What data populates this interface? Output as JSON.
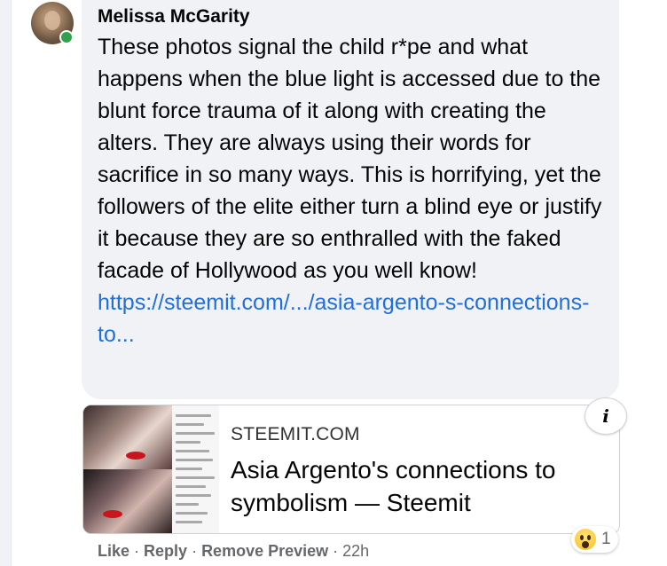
{
  "comment": {
    "author": "Melissa McGarity",
    "text": "These photos signal the child r*pe and what happens when the blue light is accessed due to the blunt force trauma of it along with creating the alters. They are always using their words for sacrifice in so many ways. This is horrifying, yet the followers of the elite either turn a blind eye or justify it because they are so enthralled with the faked facade of Hollywood as you well know!",
    "link_text": "https://steemit.com/.../asia-argento-s-connections-to..."
  },
  "preview": {
    "domain": "STEEMIT.COM",
    "title": "Asia Argento's connections to symbolism — Steemit",
    "info_glyph": "i"
  },
  "actions": {
    "like": "Like",
    "reply": "Reply",
    "remove_preview": "Remove Preview",
    "separator": "·",
    "timestamp": "22h"
  },
  "reactions": {
    "icon": "wow-reaction-icon",
    "count": "1"
  },
  "colors": {
    "bubble_bg": "#f0f2f5",
    "link": "#216fdb",
    "secondary_text": "#65676b",
    "online": "#31a24c"
  }
}
